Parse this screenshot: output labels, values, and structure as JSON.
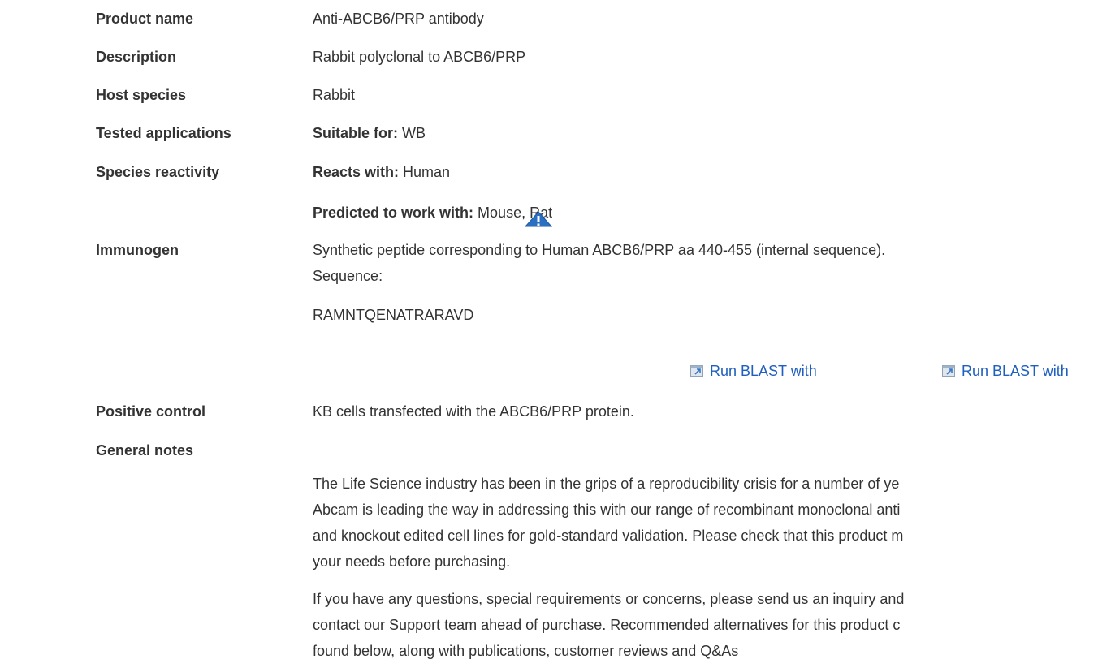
{
  "rows": {
    "product_name": {
      "label": "Product name",
      "value": "Anti-ABCB6/PRP antibody"
    },
    "description": {
      "label": "Description",
      "value": "Rabbit polyclonal to ABCB6/PRP"
    },
    "host_species": {
      "label": "Host species",
      "value": "Rabbit"
    },
    "tested_applications": {
      "label": "Tested applications",
      "prefix": "Suitable for:",
      "value": "WB"
    },
    "species_reactivity": {
      "label": "Species reactivity",
      "reacts_prefix": "Reacts with:",
      "reacts_value": "Human",
      "predicted_prefix": "Predicted to work with:",
      "predicted_value": "Mouse, Rat"
    },
    "immunogen": {
      "label": "Immunogen",
      "line1": "Synthetic peptide corresponding to Human ABCB6/PRP aa 440-455 (internal sequence).",
      "line2": "Sequence:",
      "sequence": "RAMNTQENATRARAVD",
      "blast_links": [
        "Run BLAST with",
        "Run BLAST with"
      ]
    },
    "positive_control": {
      "label": "Positive control",
      "value": "KB cells transfected with the ABCB6/PRP protein."
    },
    "general_notes": {
      "label": "General notes",
      "para1": [
        "The Life Science industry has been in the grips of a reproducibility crisis for a number of ye",
        "Abcam is leading the way in addressing this with our range of recombinant monoclonal anti",
        "and knockout edited cell lines for gold-standard validation. Please check that this product m",
        "your needs before purchasing."
      ],
      "para2": [
        "If you have any questions, special requirements or concerns, please send us an inquiry and",
        "contact our Support team ahead of purchase. Recommended alternatives for this product c",
        "found below, along with publications, customer reviews and Q&As"
      ]
    }
  },
  "icons": {
    "warning": "warning-triangle-icon",
    "blast": "external-window-icon"
  },
  "colors": {
    "link": "#1f5fbf",
    "warning": "#2a6fc2",
    "text": "#333333"
  }
}
